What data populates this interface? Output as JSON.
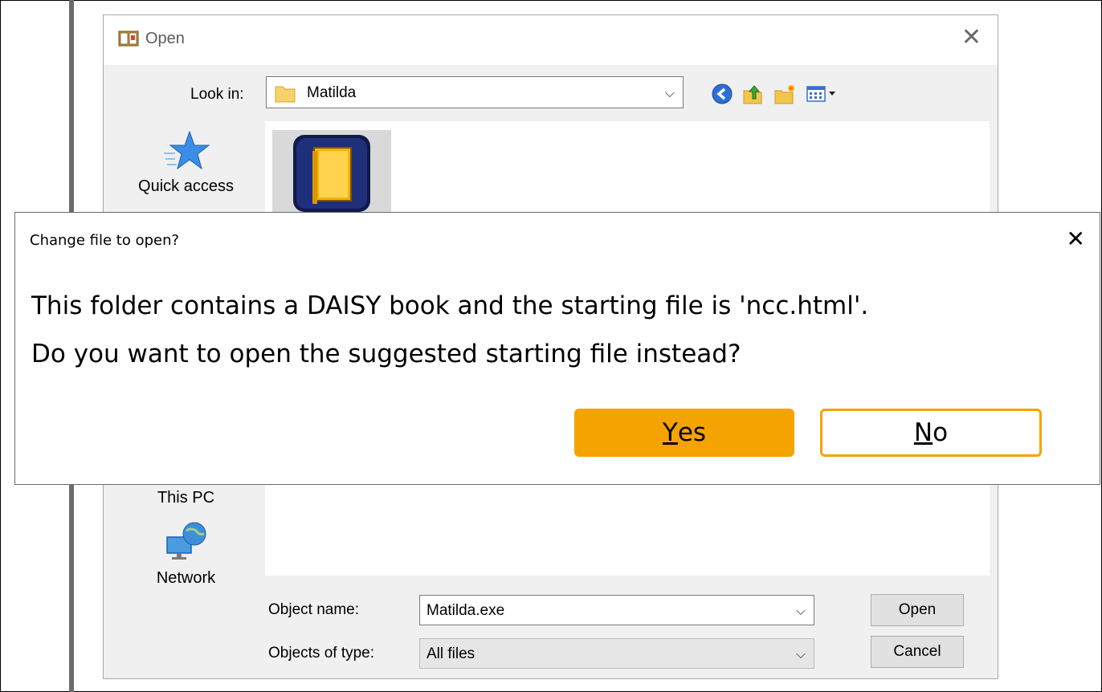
{
  "open_dialog": {
    "title": "Open",
    "look_in_label": "Look in:",
    "look_in_value": "Matilda",
    "places": {
      "quick_access": "Quick access",
      "this_pc": "This PC",
      "network": "Network"
    },
    "object_name_label": "Object name:",
    "object_name_value": "Matilda.exe",
    "objects_of_type_label": "Objects of type:",
    "objects_of_type_value": "All files",
    "open_button": "Open",
    "cancel_button": "Cancel"
  },
  "message_dialog": {
    "title": "Change file to open?",
    "line1": "This folder contains a DAISY book and the starting file is 'ncc.html'.",
    "line2": "Do you want to open the suggested starting file instead?",
    "yes_hotkey": "Y",
    "yes_rest": "es",
    "no_hotkey": "N",
    "no_rest": "o"
  },
  "colors": {
    "accent": "#f5a300",
    "dialog_bg": "#f0f0f0",
    "app_icon_bg": "#1f2f7a"
  },
  "icons": [
    "book-icon",
    "close-icon",
    "folder-icon",
    "chevron-down-icon",
    "back-icon",
    "up-folder-icon",
    "new-folder-icon",
    "view-menu-icon",
    "quick-access-star-icon",
    "network-icon",
    "app-book-icon"
  ]
}
